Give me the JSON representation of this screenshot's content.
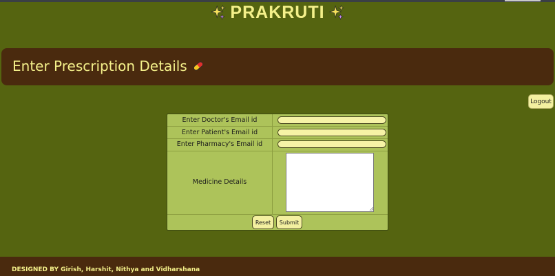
{
  "site": {
    "title": "PRAKRUTI",
    "title_icon": "sparkles-icon"
  },
  "header": {
    "title": "Enter Prescription Details",
    "icon": "pill-icon"
  },
  "logout": {
    "label": "Logout"
  },
  "form": {
    "doctor_email_label": "Enter Doctor's Email id",
    "patient_email_label": "Enter Patient's Email id",
    "pharmacy_email_label": "Enter Pharmacy's Email id",
    "medicine_label": "Medicine Details",
    "doctor_email_value": "",
    "patient_email_value": "",
    "pharmacy_email_value": "",
    "medicine_value": "",
    "reset_label": "Reset",
    "submit_label": "Submit"
  },
  "footer": {
    "text": "DESIGNED BY Girish, Harshit, Nithya and Vidharshana"
  },
  "colors": {
    "page_background": "#556410",
    "header_background": "#4a2a0e",
    "accent_text": "#f4f08a",
    "form_background": "#adc35a",
    "input_background": "#f6f3a6"
  }
}
